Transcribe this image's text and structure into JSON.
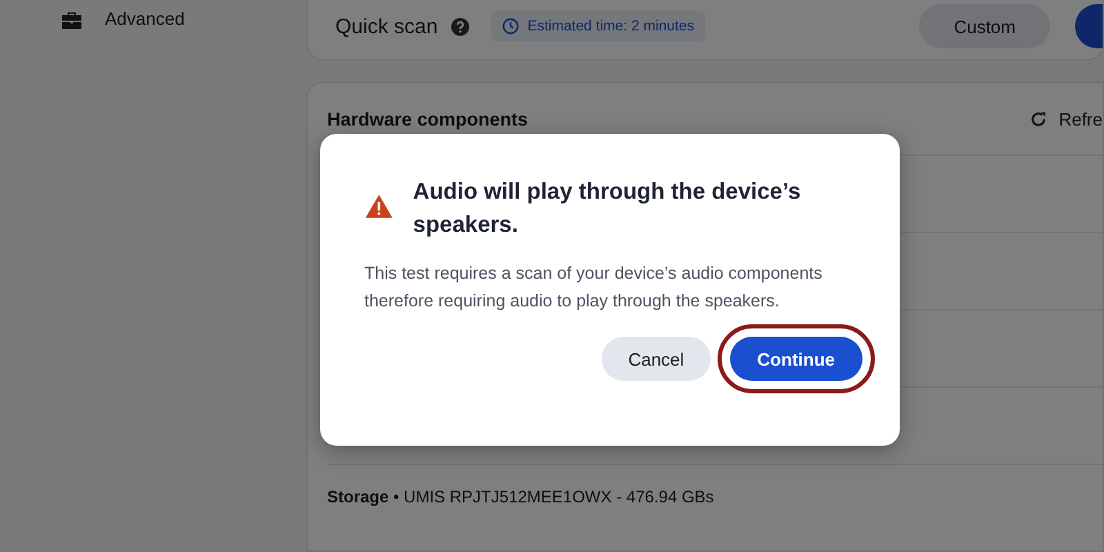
{
  "sidebar": {
    "items": [
      {
        "label": "Advanced"
      }
    ]
  },
  "scan_card": {
    "title": "Quick scan",
    "estimate": "Estimated time: 2 minutes",
    "buttons": [
      {
        "label": "Custom",
        "kind": "secondary"
      },
      {
        "kind": "primary"
      }
    ]
  },
  "hardware": {
    "title": "Hardware components",
    "refresh": "Refre",
    "rows": [
      {
        "text": "**Storage** • UMIS RPJTJ512MEE1OWX - 476.94 GBs"
      }
    ]
  },
  "dialog": {
    "title": "Audio will play through the device’s speakers.",
    "body": "This test requires a scan of your device’s audio components therefore requiring audio to play through the speakers.",
    "buttons": [
      {
        "label": "Cancel",
        "kind": "secondary",
        "highlighted": false
      },
      {
        "label": "Continue",
        "kind": "primary",
        "highlighted": true
      }
    ]
  }
}
